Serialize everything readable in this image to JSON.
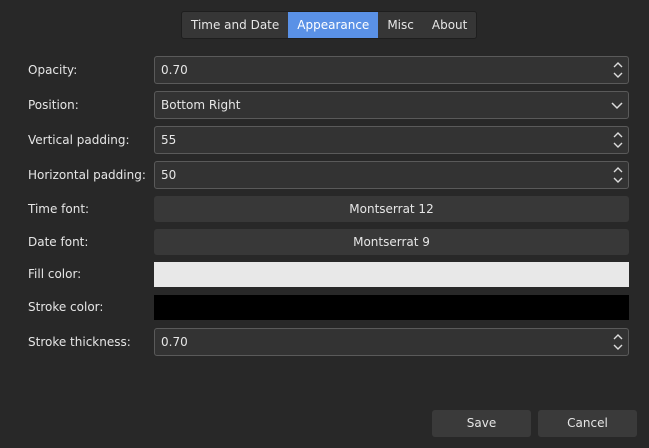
{
  "tabs": [
    {
      "label": "Time and Date",
      "active": false
    },
    {
      "label": "Appearance",
      "active": true
    },
    {
      "label": "Misc",
      "active": false
    },
    {
      "label": "About",
      "active": false
    }
  ],
  "form": {
    "opacity": {
      "label": "Opacity:",
      "value": "0.70"
    },
    "position": {
      "label": "Position:",
      "value": "Bottom Right"
    },
    "vertical_padding": {
      "label": "Vertical padding:",
      "value": "55"
    },
    "horizontal_padding": {
      "label": "Horizontal padding:",
      "value": "50"
    },
    "time_font": {
      "label": "Time font:",
      "value": "Montserrat 12"
    },
    "date_font": {
      "label": "Date font:",
      "value": "Montserrat 9"
    },
    "fill_color": {
      "label": "Fill color:",
      "color": "#e8e8e8"
    },
    "stroke_color": {
      "label": "Stroke color:",
      "color": "#000000"
    },
    "stroke_thickness": {
      "label": "Stroke thickness:",
      "value": "0.70"
    }
  },
  "footer": {
    "save_label": "Save",
    "cancel_label": "Cancel"
  },
  "theme": {
    "accent": "#5a91e6",
    "background": "#282828"
  }
}
